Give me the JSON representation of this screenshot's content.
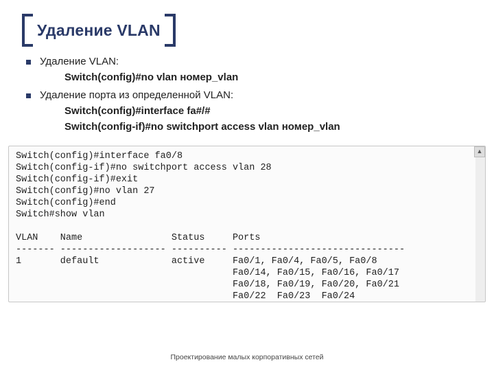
{
  "title": "Удаление VLAN",
  "bullets": [
    {
      "text": "Удаление VLAN:",
      "subs": [
        "Switch(config)#no vlan номер_vlan"
      ]
    },
    {
      "text": "Удаление порта из определенной VLAN:",
      "subs": [
        "Switch(config)#interface fa#/#",
        "Switch(config-if)#no switchport access vlan номер_vlan"
      ]
    }
  ],
  "terminal": "Switch(config)#interface fa0/8\nSwitch(config-if)#no switchport access vlan 28\nSwitch(config-if)#exit\nSwitch(config)#no vlan 27\nSwitch(config)#end\nSwitch#show vlan\n\nVLAN    Name                Status     Ports\n------- ------------------- ---------- -------------------------------\n1       default             active     Fa0/1, Fa0/4, Fa0/5, Fa0/8\n                                       Fa0/14, Fa0/15, Fa0/16, Fa0/17\n                                       Fa0/18, Fa0/19, Fa0/20, Fa0/21\n                                       Fa0/22  Fa0/23  Fa0/24",
  "scroll_up": "▲",
  "footer": "Проектирование малых корпоративных сетей"
}
